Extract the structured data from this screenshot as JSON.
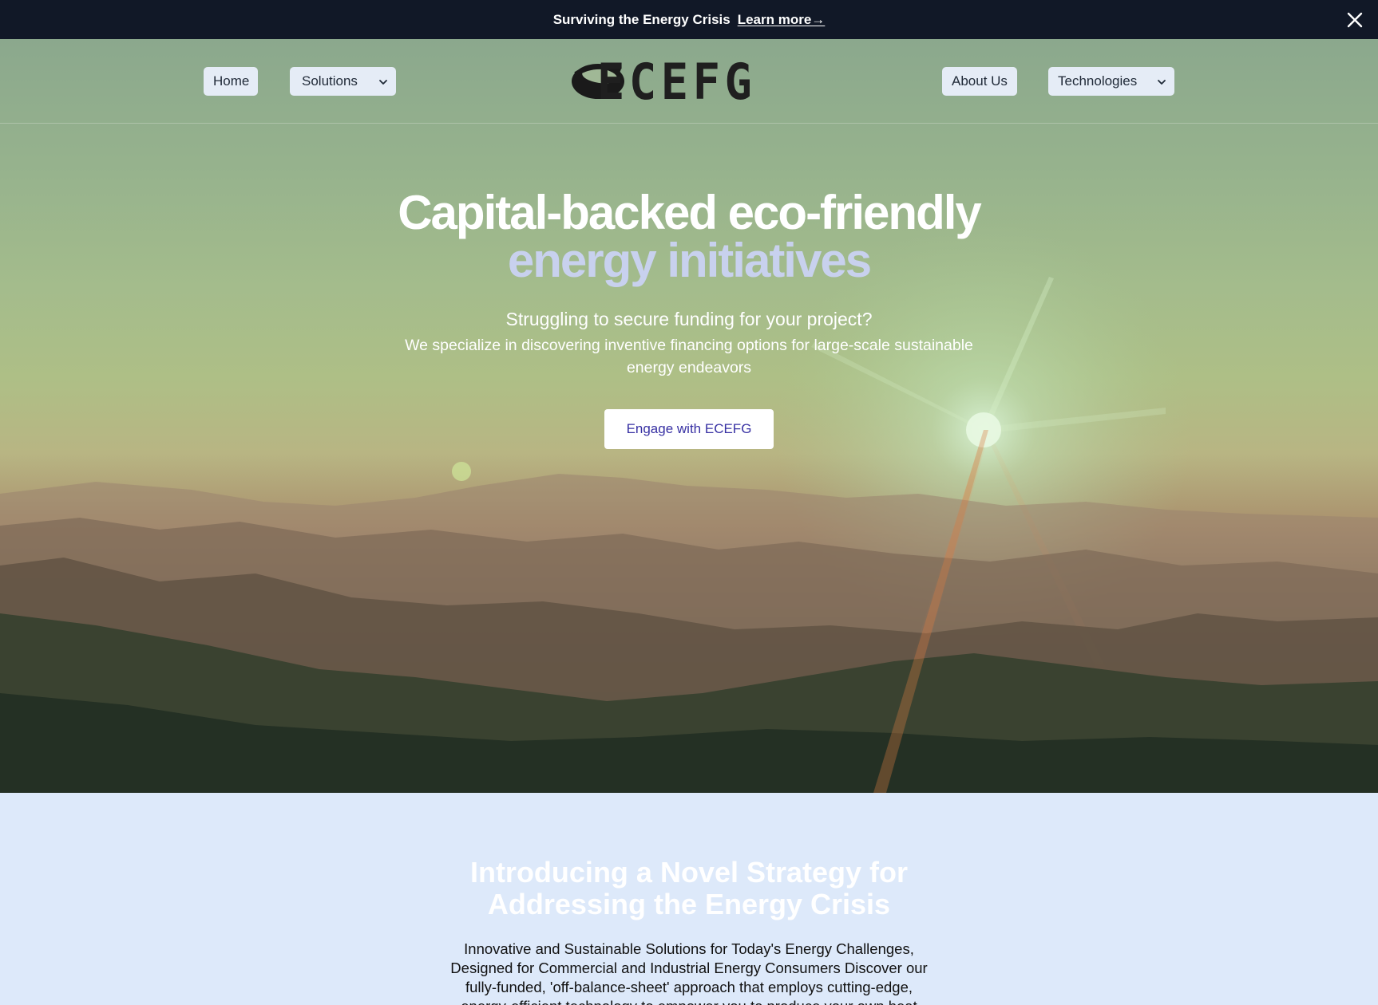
{
  "announcement": {
    "text": "Surviving the Energy Crisis",
    "link_label": "Learn more→",
    "close_icon": "close-icon"
  },
  "nav": {
    "home_label": "Home",
    "solutions_label": "Solutions",
    "about_label": "About Us",
    "technologies_label": "Technologies",
    "logo_text": "ECEFG",
    "dropdown_icon": "chevron-down-icon"
  },
  "hero": {
    "title_line1": "Capital-backed eco-friendly",
    "title_line2": "energy initiatives",
    "subtitle": "Struggling to secure funding for your project?",
    "description": "We specialize in discovering inventive financing options for large-scale sustainable energy endeavors",
    "cta_label": "Engage with ECEFG"
  },
  "intro": {
    "heading": "Introducing a Novel Strategy for Addressing the Energy Crisis",
    "body": "Innovative and Sustainable Solutions for Today's Energy Challenges, Designed for Commercial and Industrial Energy Consumers Discover our fully-funded, 'off-balance-sheet' approach that employs cutting-edge, energy-efficient technology to empower you to produce your own heat"
  },
  "colors": {
    "announcement_bg": "#111827",
    "accent_text": "#c8d1ee",
    "cta_text": "#3730a3",
    "section_bg": "#dde9fa"
  }
}
